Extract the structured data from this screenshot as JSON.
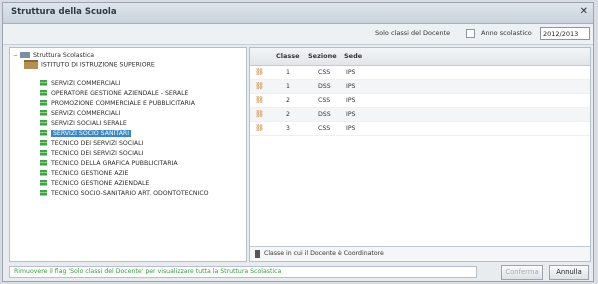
{
  "window": {
    "title": "Struttura della Scuola"
  },
  "toolbar": {
    "only_teacher_classes_label": "Solo classi del Docente",
    "school_year_label": "Anno scolastico",
    "school_year_value": "2012/2013"
  },
  "tree": {
    "root_label": "Struttura Scolastica",
    "school_label": "ISTITUTO DI ISTRUZIONE SUPERIORE",
    "courses": [
      "SERVIZI COMMERCIALI",
      "OPERATORE GESTIONE AZIENDALE - SERALE",
      "PROMOZIONE COMMERCIALE E PUBBLICITARIA",
      "SERVIZI COMMERCIALI",
      "SERVIZI SOCIALI SERALE",
      "SERVIZI SOCIO SANITARI",
      "TECNICO DEI SERVIZI SOCIALI",
      "TECNICO DEI SERVIZI SOCIALI",
      "TECNICO DELLA GRAFICA PUBBLICITARIA",
      "TECNICO GESTIONE AZIE",
      "TECNICO GESTIONE AZIENDALE",
      "TECNICO SOCIO-SANITARIO ART. ODONTOTECNICO"
    ],
    "selected_index": 5
  },
  "grid": {
    "columns": [
      "Classe",
      "Sezione",
      "Sede"
    ],
    "rows": [
      {
        "classe": "1",
        "sezione": "CSS",
        "sede": "IPS"
      },
      {
        "classe": "1",
        "sezione": "DSS",
        "sede": "IPS"
      },
      {
        "classe": "2",
        "sezione": "CSS",
        "sede": "IPS"
      },
      {
        "classe": "2",
        "sezione": "DSS",
        "sede": "IPS"
      },
      {
        "classe": "3",
        "sezione": "CSS",
        "sede": "IPS"
      }
    ],
    "legend": "Classe in cui il Docente è Coordinatore"
  },
  "status": {
    "message": "Rimuovere il flag 'Solo classi del Docente' per visualizzare tutta la Struttura Scolastica"
  },
  "buttons": {
    "confirm_label": "Conferma",
    "cancel_label": "Annulla"
  }
}
